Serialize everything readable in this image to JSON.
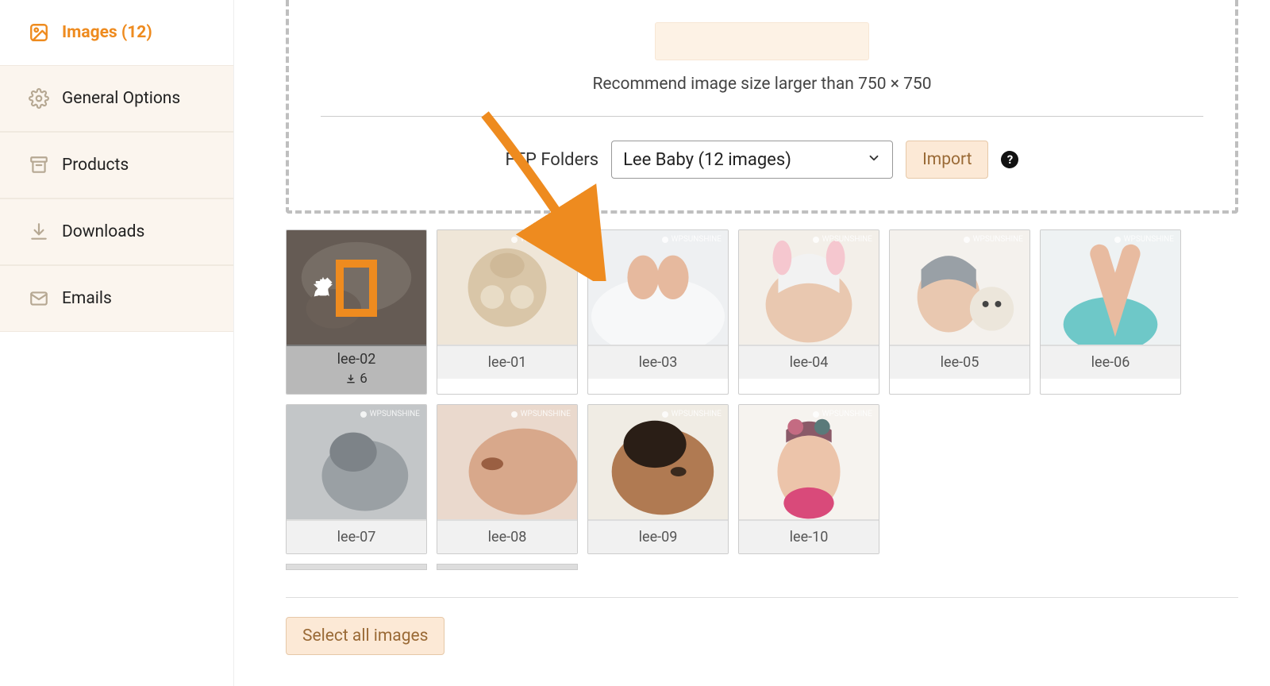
{
  "sidebar": {
    "items": [
      {
        "label": "Images (12)"
      },
      {
        "label": "General Options"
      },
      {
        "label": "Products"
      },
      {
        "label": "Downloads"
      },
      {
        "label": "Emails"
      }
    ]
  },
  "upload": {
    "recommend_text": "Recommend image size larger than 750 × 750",
    "ftp_label": "FTP Folders",
    "ftp_selected": "Lee Baby (12 images)",
    "import_label": "Import",
    "help_symbol": "?"
  },
  "gallery": {
    "items": [
      {
        "name": "lee-02",
        "downloads": "6",
        "active": true
      },
      {
        "name": "lee-01"
      },
      {
        "name": "lee-03"
      },
      {
        "name": "lee-04"
      },
      {
        "name": "lee-05"
      },
      {
        "name": "lee-06"
      },
      {
        "name": "lee-07"
      },
      {
        "name": "lee-08"
      },
      {
        "name": "lee-09"
      },
      {
        "name": "lee-10"
      }
    ],
    "watermark_text": "WPSUNSHINE"
  },
  "actions": {
    "select_all": "Select all images"
  }
}
